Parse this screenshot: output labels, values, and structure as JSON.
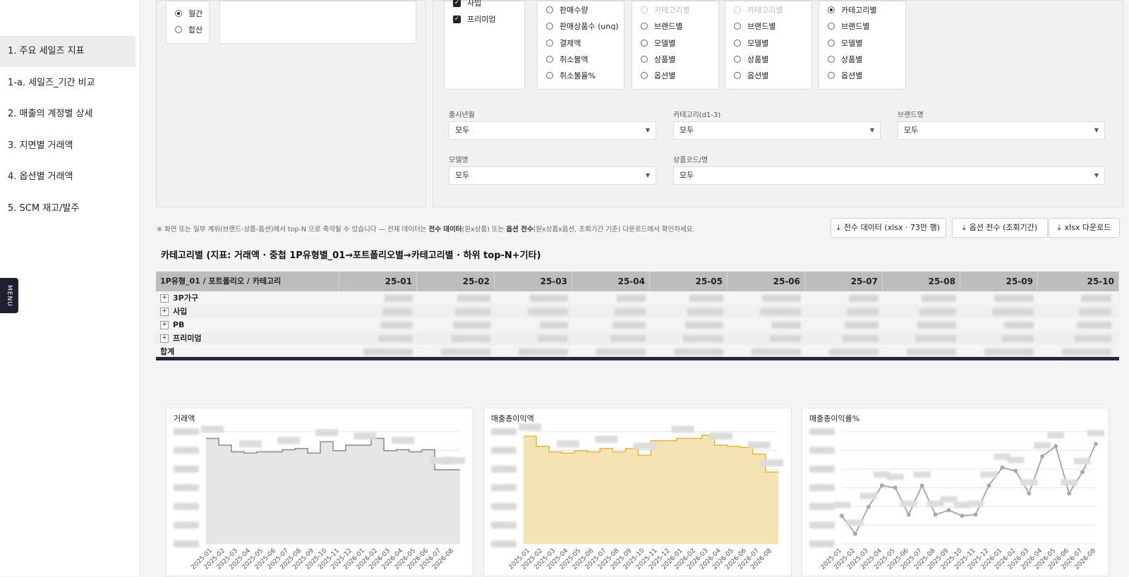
{
  "sidebar": {
    "items": [
      {
        "label": "1. 주요 세일즈 지표",
        "active": true
      },
      {
        "label": "1-a. 세일즈_기간 비교",
        "active": false
      },
      {
        "label": "2. 매출의 계정별 상세",
        "active": false
      },
      {
        "label": "3. 지면별 거래액",
        "active": false
      },
      {
        "label": "4. 옵션별 거래액",
        "active": false
      },
      {
        "label": "5. SCM 재고/발주",
        "active": false
      }
    ],
    "menu_tab": "MENU"
  },
  "filters": {
    "period": {
      "options": [
        "월간",
        "합산"
      ],
      "selected": "월간"
    },
    "types": {
      "options": [
        "사입",
        "프리미엄"
      ],
      "checked": [
        "사입",
        "프리미엄"
      ]
    },
    "metric": {
      "options": [
        "판매수량",
        "판매상품수 (unq)",
        "결제액",
        "취소불액",
        "취소불율%"
      ]
    },
    "group_b": {
      "options": [
        "카테고리별",
        "브랜드별",
        "모델별",
        "상품별",
        "옵션별"
      ],
      "disabled": [
        "카테고리별"
      ]
    },
    "group_c": {
      "options": [
        "카테고리별",
        "브랜드별",
        "모델별",
        "상품별",
        "옵션별"
      ],
      "disabled": [
        "카테고리별"
      ]
    },
    "group_d": {
      "options": [
        "카테고리별",
        "브랜드별",
        "모델별",
        "상품별",
        "옵션별"
      ],
      "selected": "카테고리별"
    },
    "selects": {
      "launch": {
        "label": "출시년월",
        "value": "모두"
      },
      "category": {
        "label": "카테고리(d1-3)",
        "value": "모두"
      },
      "brand": {
        "label": "브랜드명",
        "value": "모두"
      },
      "model": {
        "label": "모델명",
        "value": "모두"
      },
      "product": {
        "label": "상품코드/명",
        "value": "모두"
      }
    }
  },
  "notice": {
    "prefix": "※ 화면 또는 일부 계위(브랜드-상품-옵션)에서 top-N 으로 축약될 수 있습니다 — 전체 데이터는 ",
    "bold1": "전수 데이터",
    "mid1": "(원x상품) 또는 ",
    "bold2": "옵션 전수",
    "suffix": "(원x상품x옵션, 조회기간 기준) 다운로드에서 확인하세요."
  },
  "buttons": {
    "full_data": "전수 데이터 (xlsx · 73만 행)",
    "option_full": "옵션 전수 (조회기간)",
    "xlsx": "xlsx 다운로드"
  },
  "table": {
    "title": "카테고리별 (지표: 거래액 · 중첩 1P유형별_01→포트폴리오별→카테고리별 · 하위 top-N+기타)",
    "header_first": "1P유형_01 / 포트폴리오 / 카테고리",
    "months": [
      "25-01",
      "25-02",
      "25-03",
      "25-04",
      "25-05",
      "25-06",
      "25-07",
      "25-08",
      "25-09",
      "25-10"
    ],
    "rows": [
      {
        "label": "3P가구",
        "expandable": true
      },
      {
        "label": "사입",
        "expandable": true
      },
      {
        "label": "PB",
        "expandable": true
      },
      {
        "label": "프리미엄",
        "expandable": true
      },
      {
        "label": "합계",
        "expandable": false
      }
    ]
  },
  "charts": [
    {
      "title": "거래액",
      "type": "step-area",
      "color": "#8a8a8a",
      "fill": "#e6e6e6"
    },
    {
      "title": "매출총이익액",
      "type": "step-area",
      "color": "#e2b640",
      "fill": "#f5e3b3"
    },
    {
      "title": "매출총이익률%",
      "type": "line",
      "color": "#aaaaaa",
      "fill": "none"
    }
  ],
  "chart_data": [
    {
      "type": "area",
      "title": "거래액",
      "x": [
        "2025-01",
        "2025-02",
        "2025-03",
        "2025-04",
        "2025-05",
        "2025-06",
        "2025-07",
        "2025-08",
        "2025-09",
        "2025-10",
        "2025-11",
        "2025-12",
        "2026-01",
        "2026-02",
        "2026-03",
        "2026-04",
        "2026-05",
        "2026-06",
        "2026-07",
        "2026-08"
      ],
      "y": [
        0.94,
        0.88,
        0.82,
        0.81,
        0.82,
        0.82,
        0.84,
        0.85,
        0.81,
        0.91,
        0.83,
        0.88,
        0.88,
        0.94,
        0.83,
        0.84,
        0.82,
        0.84,
        0.66,
        0.66
      ],
      "ylim": [
        0,
        1
      ]
    },
    {
      "type": "area",
      "title": "매출총이익액",
      "x": [
        "2025-01",
        "2025-02",
        "2025-03",
        "2025-04",
        "2025-05",
        "2025-06",
        "2025-07",
        "2025-08",
        "2025-09",
        "2025-10",
        "2025-11",
        "2025-12",
        "2026-01",
        "2026-02",
        "2026-03",
        "2026-04",
        "2026-05",
        "2026-06",
        "2026-07",
        "2026-08"
      ],
      "y": [
        0.96,
        0.87,
        0.82,
        0.81,
        0.83,
        0.82,
        0.85,
        0.82,
        0.85,
        0.79,
        0.92,
        0.92,
        0.94,
        0.94,
        0.97,
        0.88,
        0.87,
        0.86,
        0.8,
        0.64
      ],
      "ylim": [
        0,
        1
      ]
    },
    {
      "type": "line",
      "title": "매출총이익률%",
      "x": [
        "2025-01",
        "2025-02",
        "2025-03",
        "2025-04",
        "2025-05",
        "2025-06",
        "2025-07",
        "2025-08",
        "2025-09",
        "2025-10",
        "2025-11",
        "2025-12",
        "2026-01",
        "2026-02",
        "2026-03",
        "2026-04",
        "2026-05",
        "2026-06",
        "2026-07",
        "2026-08"
      ],
      "y": [
        0.25,
        0.09,
        0.33,
        0.52,
        0.5,
        0.26,
        0.52,
        0.26,
        0.3,
        0.25,
        0.26,
        0.52,
        0.68,
        0.65,
        0.45,
        0.78,
        0.87,
        0.45,
        0.64,
        0.89
      ],
      "ylim": [
        0,
        1
      ]
    }
  ]
}
